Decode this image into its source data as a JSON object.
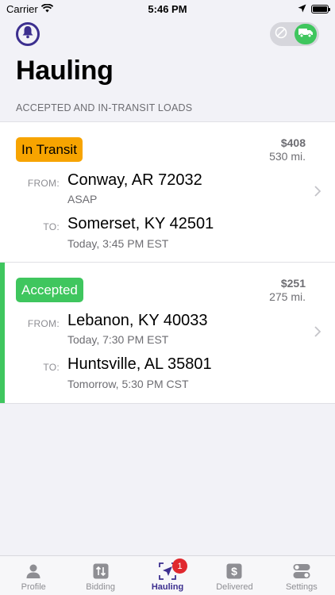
{
  "status_bar": {
    "carrier": "Carrier",
    "time": "5:46 PM"
  },
  "header": {
    "title": "Hauling",
    "section_label": "ACCEPTED AND IN-TRANSIT LOADS"
  },
  "colors": {
    "brand": "#3c2f8f",
    "in_transit": "#f7a400",
    "accepted": "#3fc65e",
    "badge_red": "#e0282e"
  },
  "loads": [
    {
      "status": "In Transit",
      "price": "$408",
      "distance": "530 mi.",
      "from_label": "FROM:",
      "from_place": "Conway, AR 72032",
      "from_time": "ASAP",
      "to_label": "TO:",
      "to_place": "Somerset, KY 42501",
      "to_time": "Today, 3:45 PM EST"
    },
    {
      "status": "Accepted",
      "price": "$251",
      "distance": "275 mi.",
      "from_label": "FROM:",
      "from_place": "Lebanon, KY 40033",
      "from_time": "Today, 7:30 PM EST",
      "to_label": "TO:",
      "to_place": "Huntsville, AL 35801",
      "to_time": "Tomorrow, 5:30 PM CST"
    }
  ],
  "tabs": [
    {
      "label": "Profile",
      "icon": "person-icon"
    },
    {
      "label": "Bidding",
      "icon": "arrows-updown-icon"
    },
    {
      "label": "Hauling",
      "icon": "navigation-arrow-icon",
      "badge": "1",
      "active": true
    },
    {
      "label": "Delivered",
      "icon": "dollar-icon"
    },
    {
      "label": "Settings",
      "icon": "toggles-icon"
    }
  ]
}
